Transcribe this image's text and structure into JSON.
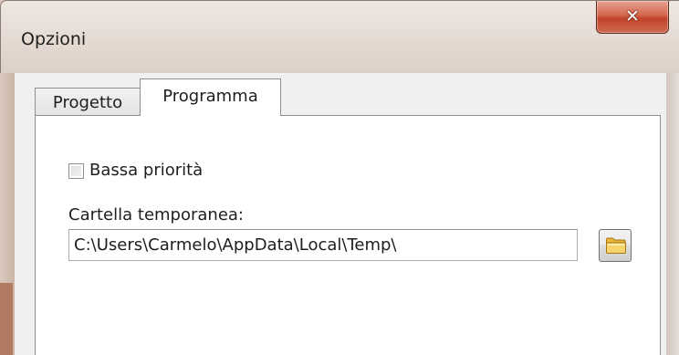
{
  "window": {
    "title": "Opzioni",
    "close_glyph": "✕"
  },
  "tabs": [
    {
      "label": "Progetto",
      "active": false
    },
    {
      "label": "Programma",
      "active": true
    }
  ],
  "program_tab": {
    "low_priority": {
      "label": "Bassa priorità",
      "checked": false
    },
    "temp_folder": {
      "label": "Cartella temporanea:",
      "value": "C:\\Users\\Carmelo\\AppData\\Local\\Temp\\"
    },
    "browse_icon": "folder-icon"
  },
  "colors": {
    "frame_accent": "#b07a63",
    "close_button": "#c0432b",
    "folder": "#f2c94c"
  }
}
